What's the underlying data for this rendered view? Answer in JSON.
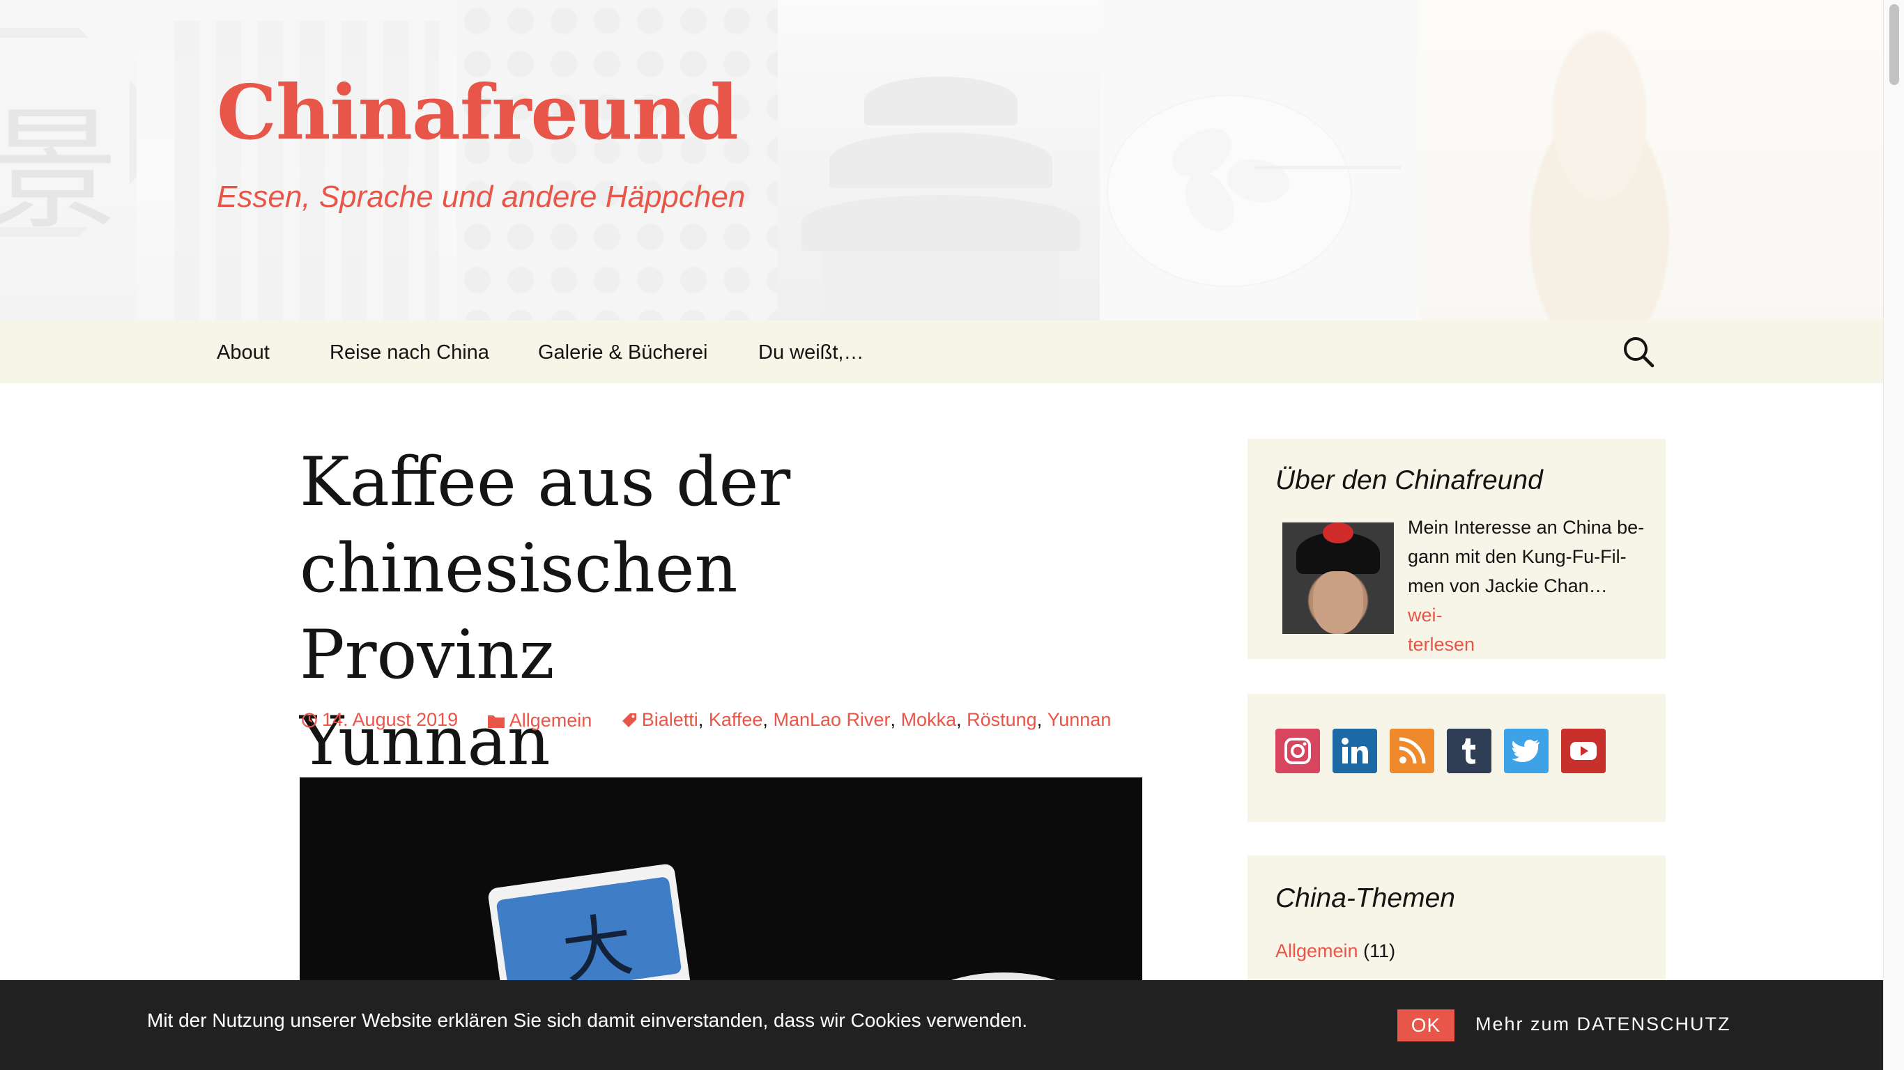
{
  "site": {
    "title": "Chinafreund",
    "description": "Essen, Sprache und andere Häppchen"
  },
  "nav": {
    "items": [
      {
        "label": "About"
      },
      {
        "label": "Reise nach China"
      },
      {
        "label": "Galerie & Bücherei"
      },
      {
        "label": "Du weißt,…"
      }
    ],
    "search_icon": "search-icon"
  },
  "article": {
    "title_lines": [
      "Kaffee aus der",
      "chinesischen Provinz",
      "Yunnan"
    ],
    "date": "14. August 2019",
    "category": "Allgemein",
    "tags": [
      "Bialetti",
      "Kaffee",
      "ManLao River",
      "Mokka",
      "Röstung",
      "Yunnan"
    ],
    "featured_image_char": "大"
  },
  "sidebar": {
    "about": {
      "title": "Über den Chinafreund",
      "text_lines": [
        "Mein Interesse an China be-",
        "gann mit den Kung-Fu-Fil-",
        "men von Jackie Chan…"
      ],
      "more_line1": "wei-",
      "more_line2": "terlesen"
    },
    "social": [
      {
        "name": "instagram-icon",
        "color": "#d8455f"
      },
      {
        "name": "linkedin-icon",
        "color": "#1c69a6"
      },
      {
        "name": "rss-icon",
        "color": "#ee8a2c"
      },
      {
        "name": "tumblr-icon",
        "color": "#2f3d55"
      },
      {
        "name": "twitter-icon",
        "color": "#3ea2e6"
      },
      {
        "name": "youtube-icon",
        "color": "#c8312b"
      }
    ],
    "topics": {
      "title": "China-Themen",
      "items": [
        {
          "label": "Allgemein",
          "count": "(11)"
        }
      ]
    }
  },
  "cookie": {
    "text": "Mit der Nutzung unserer Website erklären Sie sich damit einverstanden, dass wir Cookies verwenden.",
    "ok_label": "OK",
    "privacy_label": "Mehr zum DATENSCHUTZ"
  },
  "colors": {
    "accent": "#e8564a",
    "nav_background": "#f7f5e7",
    "cookie_background": "#212121"
  }
}
